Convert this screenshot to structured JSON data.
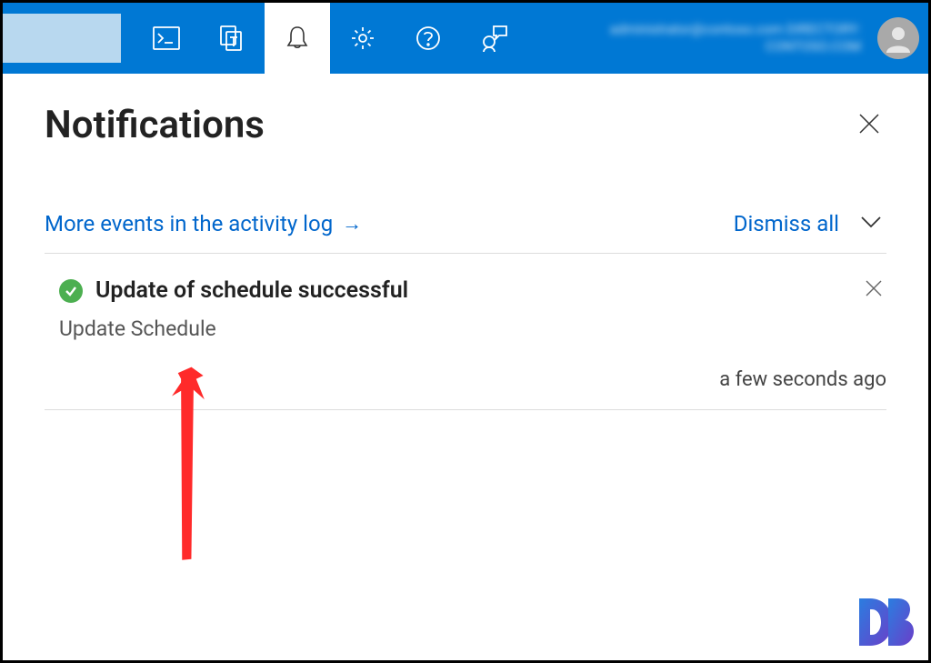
{
  "header": {
    "user_text": "administrator@contoso.com\nDIRECTORY: CONTOSO.COM"
  },
  "panel": {
    "title": "Notifications",
    "activity_log_link": "More events in the activity log",
    "dismiss_all": "Dismiss all"
  },
  "notifications": [
    {
      "status": "success",
      "title": "Update of schedule successful",
      "body": "Update Schedule",
      "time": "a few seconds ago"
    }
  ]
}
